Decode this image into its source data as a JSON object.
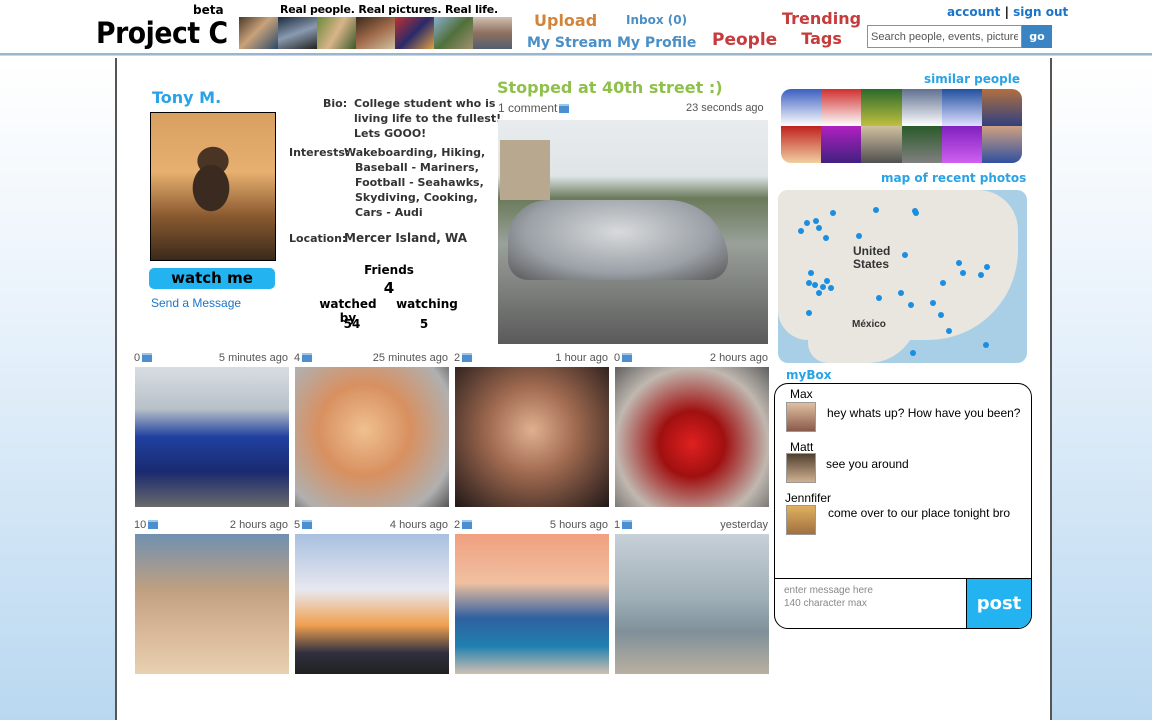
{
  "header": {
    "logo": "Project C",
    "beta": "beta",
    "tagline": "Real people. Real pictures. Real life.",
    "nav": {
      "upload": "Upload",
      "my_stream": "My Stream",
      "inbox": "Inbox (0)",
      "my_profile": "My Profile",
      "people": "People",
      "trending_line1": "Trending",
      "trending_line2": "Tags"
    },
    "search_placeholder": "Search people, events, pictures",
    "search_button": "go",
    "account": "account",
    "separator": "|",
    "sign_out": "sign out"
  },
  "profile": {
    "name": "Tony M.",
    "watch_button": "watch me",
    "send_message": "Send a Message",
    "bio_label": "Bio:",
    "bio": [
      "College student who is",
      "living life to the fullest!",
      "Lets GOOO!"
    ],
    "interests_label": "Interests:",
    "interests": [
      "Wakeboarding, Hiking,",
      "Baseball - Mariners,",
      "Football - Seahawks,",
      "Skydiving, Cooking,",
      "Cars - Audi"
    ],
    "location_label": "Location:",
    "location": "Mercer Island, WA",
    "friends_label": "Friends",
    "friends_count": "4",
    "watched_by_label": "watched by",
    "watched_by_count": "54",
    "watching_label": "watching",
    "watching_count": "5"
  },
  "featured": {
    "title": "Stopped at 40th street :)",
    "comments": "1 comment",
    "time": "23 seconds ago"
  },
  "photos": [
    {
      "count": "0",
      "time": "5 minutes ago"
    },
    {
      "count": "4",
      "time": "25 minutes ago"
    },
    {
      "count": "2",
      "time": "1 hour ago"
    },
    {
      "count": "0",
      "time": "2 hours ago"
    },
    {
      "count": "10",
      "time": "2 hours ago"
    },
    {
      "count": "5",
      "time": "4 hours ago"
    },
    {
      "count": "2",
      "time": "5 hours ago"
    },
    {
      "count": "1",
      "time": "yesterday"
    }
  ],
  "sidebar": {
    "similar_people": "similar people",
    "map_title": "map of recent photos",
    "map_labels": {
      "country1_line1": "United",
      "country1_line2": "States",
      "country2": "México"
    },
    "mybox_title": "myBox",
    "messages": [
      {
        "name": "Max",
        "text": "hey whats up? How have you been?"
      },
      {
        "name": "Matt",
        "text": "see you around"
      },
      {
        "name": "Jennfifer",
        "text": "come over to our place tonight bro"
      }
    ],
    "input_placeholder_1": "enter message here",
    "input_placeholder_2": "140 character max",
    "post_button": "post"
  },
  "colors": {
    "accent_blue": "#22b3f0",
    "link_blue": "#1a75c9",
    "upload_orange": "#d2843a",
    "people_red": "#c63b3b",
    "title_green": "#8fc04a"
  }
}
